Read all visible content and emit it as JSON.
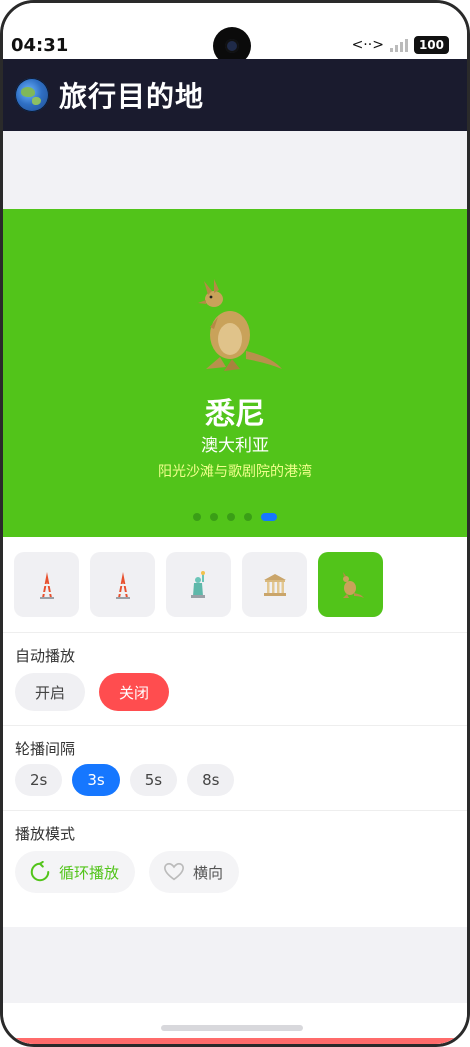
{
  "status_bar": {
    "time": "04:31",
    "network": "<··>",
    "battery": "100"
  },
  "header": {
    "title": "旅行目的地",
    "icon": "globe-icon"
  },
  "carousel": {
    "background": "#52c41a",
    "icon": "kangaroo-icon",
    "title": "悉尼",
    "subtitle": "澳大利亚",
    "description": "阳光沙滩与歌剧院的港湾",
    "slide_count": 5,
    "active_index": 4
  },
  "thumbnails": [
    {
      "icon": "tokyo-tower-icon",
      "active": false
    },
    {
      "icon": "tokyo-tower-icon",
      "active": false
    },
    {
      "icon": "statue-of-liberty-icon",
      "active": false
    },
    {
      "icon": "classical-building-icon",
      "active": false
    },
    {
      "icon": "kangaroo-icon",
      "active": true
    }
  ],
  "autoplay": {
    "label": "自动播放",
    "on_label": "开启",
    "off_label": "关闭",
    "selected": "off"
  },
  "interval": {
    "label": "轮播间隔",
    "options": [
      "2s",
      "3s",
      "5s",
      "8s"
    ],
    "selected": "3s"
  },
  "play_mode": {
    "label": "播放模式",
    "loop_label": "循环播放",
    "horizontal_label": "横向",
    "loop_icon": "loop-icon",
    "horizontal_icon": "heart-outline-icon"
  },
  "colors": {
    "accent_green": "#52c41a",
    "accent_blue": "#1677ff",
    "accent_red": "#ff4d4f",
    "header_bg": "#1a1b2e"
  }
}
